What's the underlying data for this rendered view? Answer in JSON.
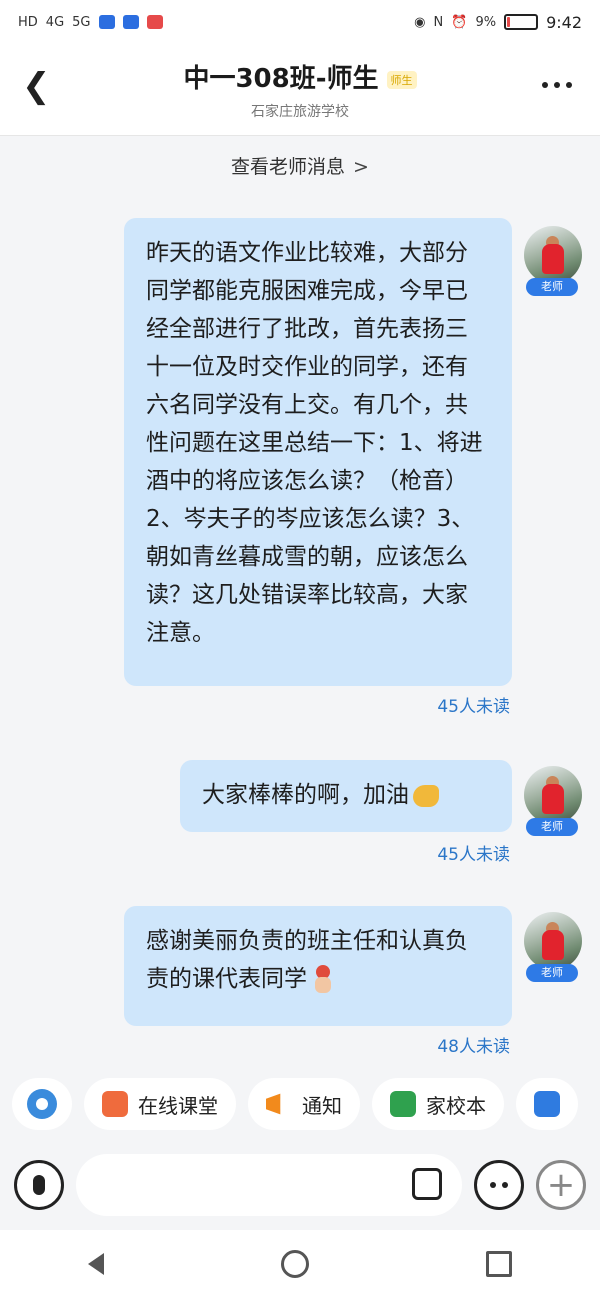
{
  "status_bar": {
    "left_indicators": [
      "HD",
      "4G",
      "5G"
    ],
    "battery_percent": "9%",
    "battery_level": 0.09,
    "time": "9:42"
  },
  "header": {
    "title": "中一308班-师生",
    "tag": "师生",
    "subtitle": "石家庄旅游学校"
  },
  "teacher_link": {
    "label": "查看老师消息",
    "chevron": ">"
  },
  "messages": [
    {
      "text": "昨天的语文作业比较难，大部分同学都能克服困难完成，今早已经全部进行了批改，首先表扬三十一位及时交作业的同学，还有六名同学没有上交。有几个，共性问题在这里总结一下：1、将进酒中的将应该怎么读？（枪音）2、岑夫子的岑应该怎么读？3、朝如青丝暮成雪的朝，应该怎么读？这几处错误率比较高，大家注意。",
      "sender_tag": "老师",
      "unread": "45人未读"
    },
    {
      "text": "大家棒棒的啊，加油",
      "emoji": "flexed-biceps",
      "sender_tag": "老师",
      "unread": "45人未读"
    },
    {
      "text": "感谢美丽负责的班主任和认真负责的课代表同学",
      "emoji": "hand-with-flower",
      "sender_tag": "老师",
      "unread": "48人未读"
    }
  ],
  "toolbar": {
    "items": [
      {
        "label": "",
        "icon": "customer-service-icon"
      },
      {
        "label": "在线课堂",
        "icon": "online-class-icon"
      },
      {
        "label": "通知",
        "icon": "megaphone-icon"
      },
      {
        "label": "家校本",
        "icon": "notebook-icon"
      }
    ]
  },
  "colors": {
    "bubble": "#cfe6fb",
    "unread": "#2b76c8",
    "badge": "#2e7ae6",
    "background": "#f4f5f7"
  }
}
